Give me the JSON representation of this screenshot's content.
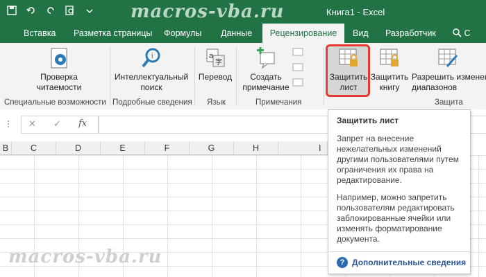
{
  "titlebar": {
    "watermark": "macros-vba.ru",
    "doc_title": "Книга1  -  Excel"
  },
  "tabs": [
    {
      "label": "Вставка"
    },
    {
      "label": "Разметка страницы"
    },
    {
      "label": "Формулы"
    },
    {
      "label": "Данные"
    },
    {
      "label": "Рецензирование",
      "active": true
    },
    {
      "label": "Вид"
    },
    {
      "label": "Разработчик"
    }
  ],
  "search_text": "С",
  "ribbon": {
    "spell_label": "Проверка\nчитаемости",
    "spell_group": "Специальные возможности",
    "smart_label": "Интеллектуальный\nпоиск",
    "smart_group": "Подробные сведения",
    "translate_label": "Перевод",
    "translate_group": "Язык",
    "new_comment_label": "Создать\nпримечание",
    "comments_group": "Примечания",
    "protect_sheet_label": "Защитить\nлист",
    "protect_book_label": "Защитить\nкнигу",
    "allow_ranges_label": "Разрешить изменен\nдиапазонов",
    "protect_group": "Защита"
  },
  "formula_bar": {
    "cancel": "✕",
    "enter": "✓",
    "fx": "fx"
  },
  "columns": [
    "B",
    "C",
    "D",
    "E",
    "F",
    "G",
    "H",
    "I"
  ],
  "tooltip": {
    "title": "Защитить лист",
    "p1": "Запрет на внесение нежелательных изменений другими пользователями путем ограничения их права на редактирование.",
    "p2": "Например, можно запретить пользователям редактировать заблокированные ячейки или изменять форматирование документа.",
    "link": "Дополнительные сведения"
  },
  "colors": {
    "accent": "#217346",
    "highlight": "#e53935",
    "link": "#2b5797"
  }
}
